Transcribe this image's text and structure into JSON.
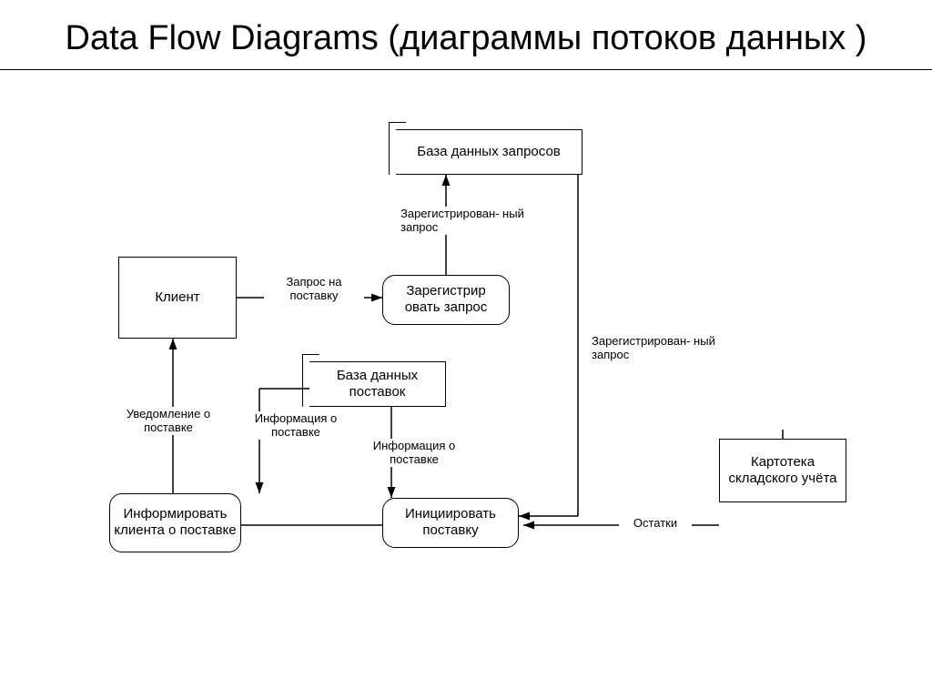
{
  "title": "Data Flow Diagrams (диаграммы потоков данных )",
  "nodes": {
    "client": "Клиент",
    "register_request": "Зарегистрир\nовать запрос",
    "request_db": "База данных\nзапросов",
    "delivery_db": "База данных\nпоставок",
    "inform_client": "Информировать\nклиента о\nпоставке",
    "initiate_delivery": "Инициировать\nпоставку",
    "warehouse_index": "Картотека\nскладского\nучёта"
  },
  "flows": {
    "request_for_delivery": "Запрос на\nпоставку",
    "registered_request_up": "Зарегистрирован-\nный запрос",
    "registered_request_down": "Зарегистрирован-\nный запрос",
    "delivery_notification": "Уведомление\nо поставке",
    "delivery_info_up": "Информация\nо поставке",
    "delivery_info_down": "Информация\nо поставке",
    "remains": "Остатки"
  }
}
